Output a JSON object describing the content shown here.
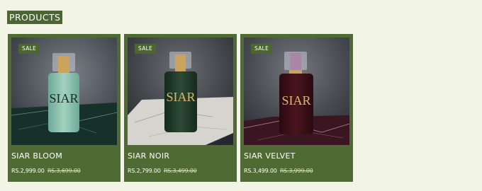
{
  "section": {
    "title": "PRODUCTS"
  },
  "colors": {
    "accent": "#4c6632",
    "card": "#4f6a33",
    "background": "#f2f4e6"
  },
  "products": [
    {
      "name": "SIAR BLOOM",
      "badge": "SALE",
      "price": "RS.2,999.00",
      "old_price": "RS.3,699.00",
      "bottle_label": "SIAR",
      "bottle_color": "#8fc4b1",
      "label_color": "#1a2a24"
    },
    {
      "name": "SIAR NOIR",
      "badge": "SALE",
      "price": "RS.2,799.00",
      "old_price": "RS.3,499.00",
      "bottle_label": "SIAR",
      "bottle_color": "#1f3a2a",
      "label_color": "#d9b86a"
    },
    {
      "name": "SIAR VELVET",
      "badge": "SALE",
      "price": "RS.3,499.00",
      "old_price": "RS.3,999.00",
      "bottle_label": "SIAR",
      "bottle_color": "#3e1118",
      "label_color": "#d9b86a"
    }
  ]
}
